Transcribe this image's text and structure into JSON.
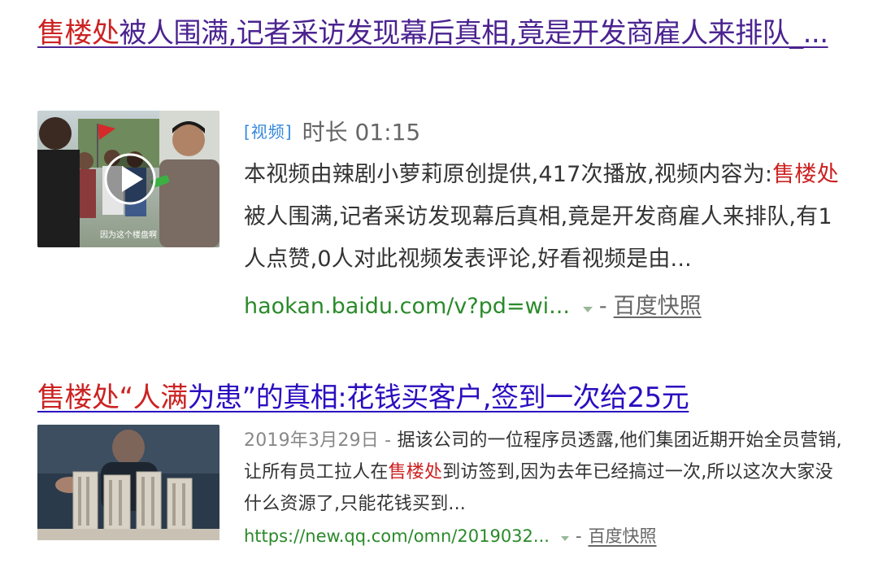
{
  "results": [
    {
      "title_highlight": "售楼处",
      "title_rest": "被人围满,记者采访发现幕后真相,竟是开发商雇人来排队_...",
      "tag": "[视频]",
      "duration_label": "时长 01:15",
      "thumbnail_caption": "因为这个楼盘啊",
      "abstract_prefix": "本视频由辣剧小萝莉原创提供,417次播放,视频内容为:",
      "abstract_highlight": "售楼处",
      "abstract_rest": "被人围满,记者采访发现幕后真相,竟是开发商雇人来排队,有1人点赞,0人对此视频发表评论,好看视频是由...",
      "url": "haokan.baidu.com/v?pd=wi...",
      "separator": "-",
      "snapshot": "百度快照"
    },
    {
      "title_highlight_1": "售楼处",
      "title_quote_open": "“",
      "title_highlight_2": "人满",
      "title_rest": "为患”的真相:花钱买客户,签到一次给25元",
      "date": "2019年3月29日",
      "date_sep": " - ",
      "abstract_prefix": "据该公司的一位程序员透露,他们集团近期开始全员营销,让所有员工拉人在",
      "abstract_highlight": "售楼处",
      "abstract_rest": "到访签到,因为去年已经搞过一次,所以这次大家没什么资源了,只能花钱买到...",
      "url": "https://new.qq.com/omn/2019032...",
      "separator": "-",
      "snapshot": "百度快照"
    }
  ]
}
